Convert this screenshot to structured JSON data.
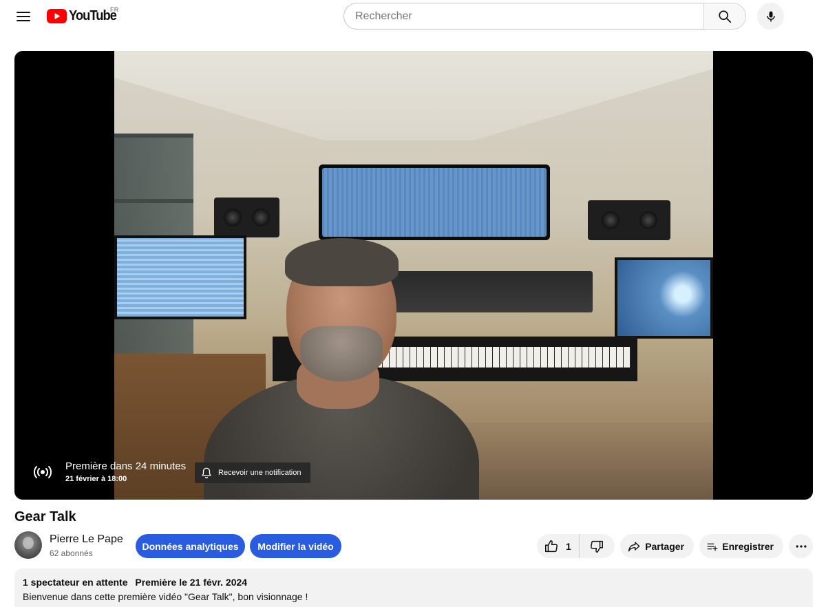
{
  "masthead": {
    "logo_text": "YouTube",
    "country_code": "FR",
    "search_placeholder": "Rechercher",
    "icons": {
      "menu": "hamburger-menu-icon",
      "search": "search-icon",
      "mic": "microphone-icon"
    },
    "brand_color": "#FF0000"
  },
  "player": {
    "premiere_line1": "Première dans 24 minutes",
    "premiere_line2": "21 février à 18:00",
    "notify_label": "Recevoir une notification",
    "icons": {
      "live": "live-broadcast-icon",
      "bell": "bell-icon"
    }
  },
  "video": {
    "title": "Gear Talk",
    "channel_name": "Pierre Le Pape",
    "subscribers": "62 abonnés",
    "analytics_label": "Données analytiques",
    "edit_label": "Modifier la vidéo",
    "like_count": "1",
    "share_label": "Partager",
    "save_label": "Enregistrer",
    "accent_color": "#2A5CE0",
    "icons": {
      "like": "thumbs-up-icon",
      "dislike": "thumbs-down-icon",
      "share": "share-icon",
      "save": "playlist-add-icon",
      "more": "more-horizontal-icon"
    }
  },
  "description": {
    "waiting": "1 spectateur en attente",
    "premiere_date": "Première le 21 févr. 2024",
    "text": "Bienvenue dans cette première vidéo \"Gear Talk\", bon visionnage !"
  }
}
